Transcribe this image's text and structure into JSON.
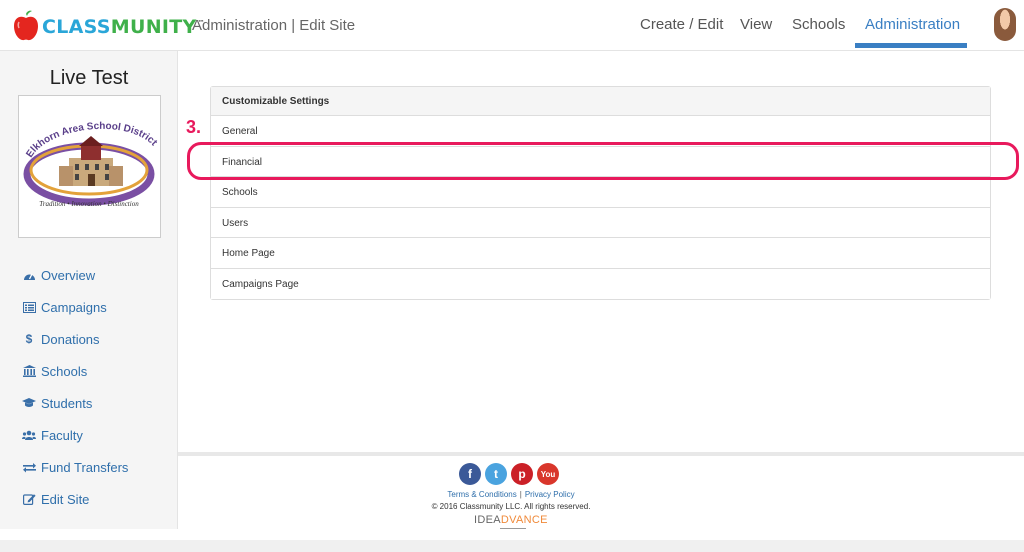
{
  "brand": {
    "logo_part1": "CLASS",
    "logo_part2": "MUNITY",
    "trademark": "™"
  },
  "header": {
    "page_title": "Administration | Edit Site",
    "nav": [
      {
        "label": "Create / Edit",
        "active": false
      },
      {
        "label": "View",
        "active": false
      },
      {
        "label": "Schools",
        "active": false
      },
      {
        "label": "Administration",
        "active": true
      }
    ]
  },
  "sidebar": {
    "site_name": "Live Test",
    "school_logo": {
      "title": "Elkhorn Area School District",
      "tagline": "Tradition • Innovation • Distinction"
    },
    "items": [
      {
        "label": "Overview",
        "icon": "dashboard-icon"
      },
      {
        "label": "Campaigns",
        "icon": "list-alt-icon"
      },
      {
        "label": "Donations",
        "icon": "dollar-icon"
      },
      {
        "label": "Schools",
        "icon": "institution-icon"
      },
      {
        "label": "Students",
        "icon": "graduation-cap-icon"
      },
      {
        "label": "Faculty",
        "icon": "users-icon"
      },
      {
        "label": "Fund Transfers",
        "icon": "exchange-icon"
      },
      {
        "label": "Edit Site",
        "icon": "edit-icon"
      }
    ]
  },
  "settings": {
    "heading": "Customizable Settings",
    "rows": [
      "General",
      "Financial",
      "Schools",
      "Users",
      "Home Page",
      "Campaigns Page"
    ]
  },
  "annotation": {
    "step": "3."
  },
  "footer": {
    "social": [
      {
        "name": "facebook",
        "glyph": "f"
      },
      {
        "name": "twitter",
        "glyph": "t"
      },
      {
        "name": "pinterest",
        "glyph": "p"
      },
      {
        "name": "youtube",
        "glyph": "You"
      }
    ],
    "terms": "Terms & Conditions",
    "separator": "|",
    "privacy": "Privacy Policy",
    "copyright": "© 2016 Classmunity LLC. All rights reserved.",
    "partner_part1": "IDEA",
    "partner_part2": "DVANCE"
  },
  "colors": {
    "accent": "#3a7fc3",
    "highlight": "#e8195c",
    "link": "#2f6fab"
  }
}
